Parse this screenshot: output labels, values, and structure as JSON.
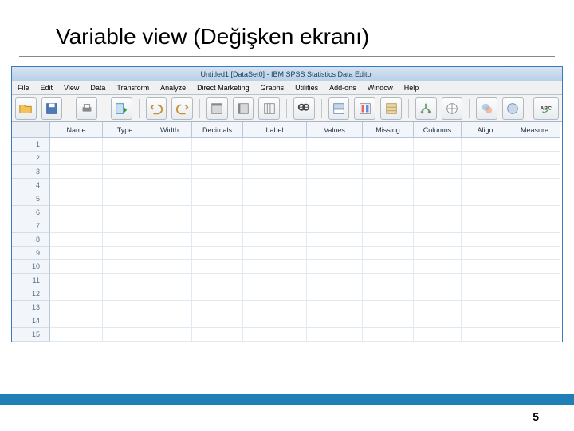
{
  "slide": {
    "title": "Variable view (Değişken ekranı)",
    "page_number": "5"
  },
  "window": {
    "title": "Untitled1 [DataSet0] - IBM SPSS Statistics Data Editor"
  },
  "menus": [
    "File",
    "Edit",
    "View",
    "Data",
    "Transform",
    "Analyze",
    "Direct Marketing",
    "Graphs",
    "Utilities",
    "Add-ons",
    "Window",
    "Help"
  ],
  "columns": [
    {
      "key": "Name",
      "cls": "w-name"
    },
    {
      "key": "Type",
      "cls": "w-type"
    },
    {
      "key": "Width",
      "cls": "w-width"
    },
    {
      "key": "Decimals",
      "cls": "w-dec"
    },
    {
      "key": "Label",
      "cls": "w-label"
    },
    {
      "key": "Values",
      "cls": "w-values"
    },
    {
      "key": "Missing",
      "cls": "w-missing"
    },
    {
      "key": "Columns",
      "cls": "w-columns"
    },
    {
      "key": "Align",
      "cls": "w-align"
    },
    {
      "key": "Measure",
      "cls": "w-measure"
    }
  ],
  "row_count": 15
}
